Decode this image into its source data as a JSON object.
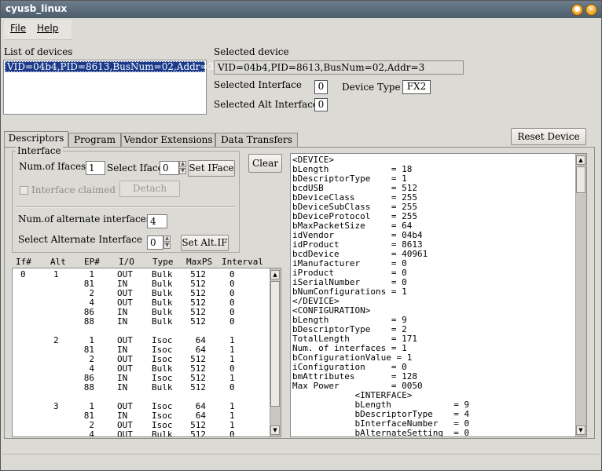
{
  "window": {
    "title": "cyusb_linux"
  },
  "menu": [
    {
      "label": "File"
    },
    {
      "label": "Help"
    }
  ],
  "devices": {
    "label": "List of devices",
    "items": [
      "VID=04b4,PID=8613,BusNum=02,Addr=3"
    ]
  },
  "selected_device": {
    "label": "Selected device",
    "value": "VID=04b4,PID=8613,BusNum=02,Addr=3"
  },
  "selected_interface": {
    "label": "Selected Interface",
    "value": "0"
  },
  "device_type": {
    "label": "Device Type",
    "value": "FX2"
  },
  "selected_alt_interface": {
    "label": "Selected Alt Interface",
    "value": "0"
  },
  "tabs": [
    {
      "label": "Descriptors",
      "active": true
    },
    {
      "label": "Program",
      "active": false
    },
    {
      "label": "Vendor Extensions",
      "active": false
    },
    {
      "label": "Data Transfers",
      "active": false
    }
  ],
  "reset_button": "Reset Device",
  "clear_button": "Clear",
  "interface_group": {
    "title": "Interface",
    "num_ifaces_label": "Num.of Ifaces",
    "num_ifaces_value": "1",
    "select_iface_label": "Select Iface",
    "select_iface_value": "0",
    "set_iface_button": "Set IFace",
    "claimed_label": "Interface claimed",
    "detach_button": "Detach",
    "num_alt_label": "Num.of alternate interfaces",
    "num_alt_value": "4",
    "select_alt_label": "Select Alternate Interface",
    "select_alt_value": "0",
    "set_alt_button": "Set Alt.IF"
  },
  "endpoints": {
    "headers": [
      "If#",
      "Alt",
      "EP#",
      "I/O",
      "Type",
      "MaxPS",
      "Interval"
    ],
    "rows": [
      [
        "0",
        "1",
        "1",
        "OUT",
        "Bulk",
        "512",
        "0"
      ],
      [
        "",
        "",
        "81",
        "IN",
        "Bulk",
        "512",
        "0"
      ],
      [
        "",
        "",
        "2",
        "OUT",
        "Bulk",
        "512",
        "0"
      ],
      [
        "",
        "",
        "4",
        "OUT",
        "Bulk",
        "512",
        "0"
      ],
      [
        "",
        "",
        "86",
        "IN",
        "Bulk",
        "512",
        "0"
      ],
      [
        "",
        "",
        "88",
        "IN",
        "Bulk",
        "512",
        "0"
      ],
      [
        "",
        "",
        "",
        "",
        "",
        "",
        ""
      ],
      [
        "",
        "2",
        "1",
        "OUT",
        "Isoc",
        "64",
        "1"
      ],
      [
        "",
        "",
        "81",
        "IN",
        "Isoc",
        "64",
        "1"
      ],
      [
        "",
        "",
        "2",
        "OUT",
        "Isoc",
        "512",
        "1"
      ],
      [
        "",
        "",
        "4",
        "OUT",
        "Bulk",
        "512",
        "0"
      ],
      [
        "",
        "",
        "86",
        "IN",
        "Isoc",
        "512",
        "1"
      ],
      [
        "",
        "",
        "88",
        "IN",
        "Bulk",
        "512",
        "0"
      ],
      [
        "",
        "",
        "",
        "",
        "",
        "",
        ""
      ],
      [
        "",
        "3",
        "1",
        "OUT",
        "Isoc",
        "64",
        "1"
      ],
      [
        "",
        "",
        "81",
        "IN",
        "Isoc",
        "64",
        "1"
      ],
      [
        "",
        "",
        "2",
        "OUT",
        "Isoc",
        "512",
        "1"
      ],
      [
        "",
        "",
        "4",
        "OUT",
        "Bulk",
        "512",
        "0"
      ]
    ]
  },
  "descriptor_text": [
    "<DEVICE>",
    "bLength            = 18",
    "bDescriptorType    = 1",
    "bcdUSB             = 512",
    "bDeviceClass       = 255",
    "bDeviceSubClass    = 255",
    "bDeviceProtocol    = 255",
    "bMaxPacketSize     = 64",
    "idVendor           = 04b4",
    "idProduct          = 8613",
    "bcdDevice          = 40961",
    "iManufacturer      = 0",
    "iProduct           = 0",
    "iSerialNumber      = 0",
    "bNumConfigurations = 1",
    "</DEVICE>",
    "<CONFIGURATION>",
    "bLength            = 9",
    "bDescriptorType    = 2",
    "TotalLength        = 171",
    "Num. of interfaces = 1",
    "bConfigurationValue = 1",
    "iConfiguration     = 0",
    "bmAttributes       = 128",
    "Max Power          = 0050",
    "            <INTERFACE>",
    "            bLength            = 9",
    "            bDescriptorType    = 4",
    "            bInterfaceNumber   = 0",
    "            bAlternateSetting  = 0"
  ]
}
